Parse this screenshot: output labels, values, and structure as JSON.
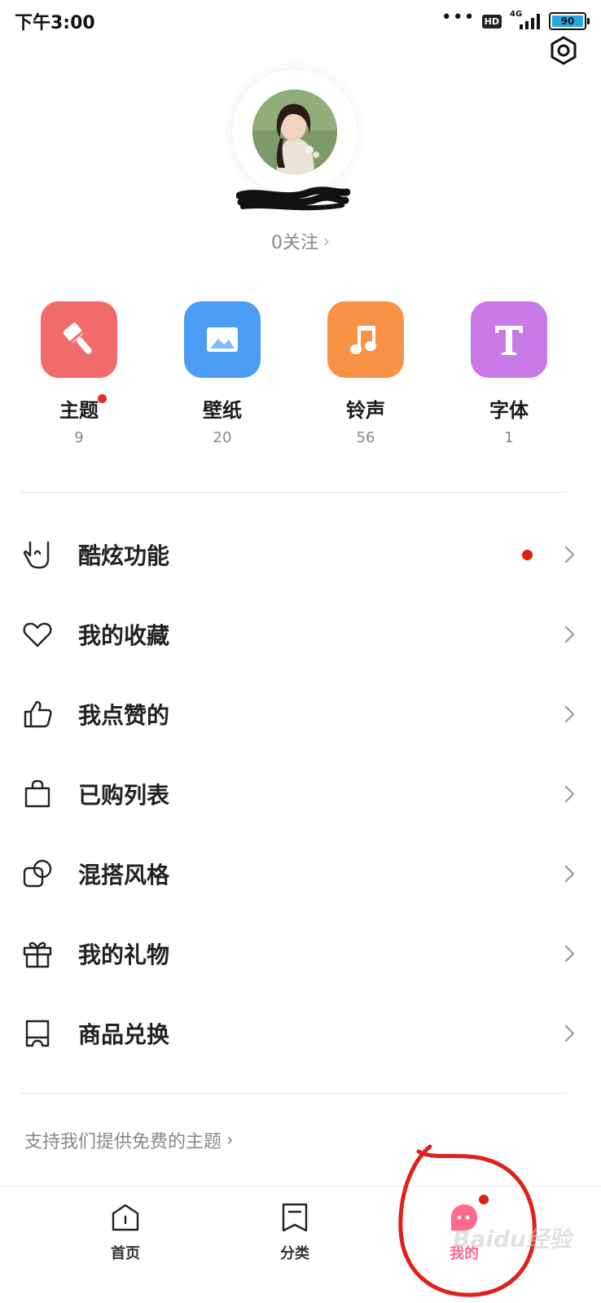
{
  "status_bar": {
    "time": "下午3:00",
    "dots": "•••",
    "hd": "HD",
    "network": "4G",
    "battery": "90"
  },
  "profile": {
    "username": "",
    "follow_text": "0关注",
    "follow_chevron": "›"
  },
  "categories": [
    {
      "label": "主题",
      "count": "9",
      "color": "#f26b6b",
      "icon": "brush-icon",
      "has_dot": true
    },
    {
      "label": "壁纸",
      "count": "20",
      "color": "#4a9cf5",
      "icon": "image-icon",
      "has_dot": false
    },
    {
      "label": "铃声",
      "count": "56",
      "color": "#f89245",
      "icon": "music-note-icon",
      "has_dot": false
    },
    {
      "label": "字体",
      "count": "1",
      "color": "#c978e8",
      "icon": "font-t-icon",
      "has_dot": false
    }
  ],
  "menu": [
    {
      "label": "酷炫功能",
      "icon": "rock-hand-icon",
      "has_dot": true
    },
    {
      "label": "我的收藏",
      "icon": "heart-icon",
      "has_dot": false
    },
    {
      "label": "我点赞的",
      "icon": "thumbs-up-icon",
      "has_dot": false
    },
    {
      "label": "已购列表",
      "icon": "shopping-bag-icon",
      "has_dot": false
    },
    {
      "label": "混搭风格",
      "icon": "mix-shapes-icon",
      "has_dot": false
    },
    {
      "label": "我的礼物",
      "icon": "gift-icon",
      "has_dot": false
    },
    {
      "label": "商品兑换",
      "icon": "ticket-icon",
      "has_dot": false
    }
  ],
  "support": {
    "text": "支持我们提供免费的主题",
    "chevron": "›"
  },
  "bottom_nav": [
    {
      "label": "首页",
      "icon": "home-icon",
      "active": false
    },
    {
      "label": "分类",
      "icon": "category-icon",
      "active": false
    },
    {
      "label": "我的",
      "icon": "mine-face-icon",
      "active": true,
      "has_dot": true
    }
  ],
  "watermark": "Baidu经验",
  "colors": {
    "accent_pink": "#ff6a8a",
    "red_dot": "#e02010",
    "annotation_red": "#e0201a"
  }
}
